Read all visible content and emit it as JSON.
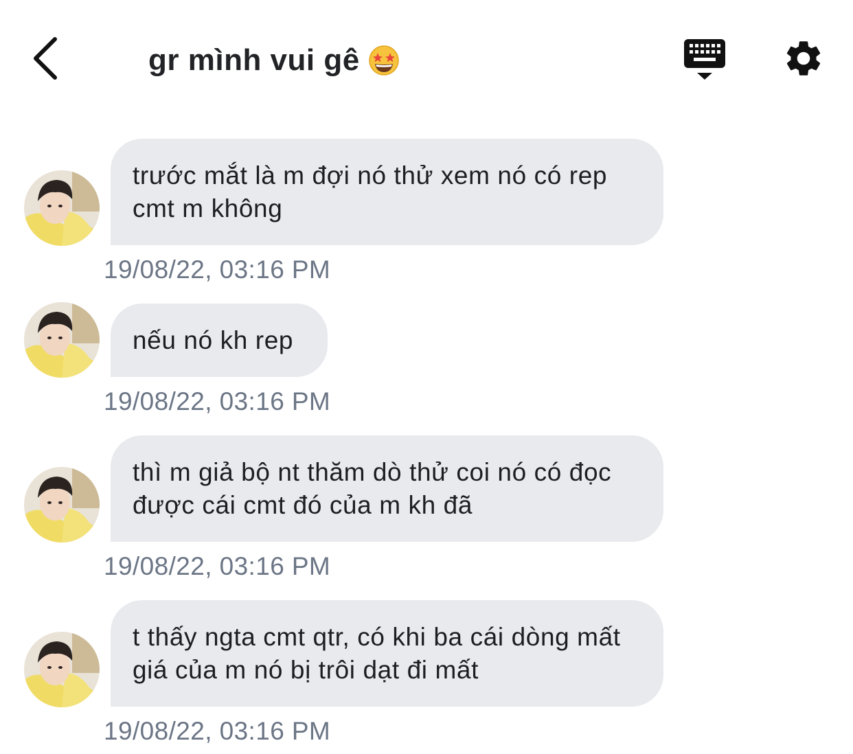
{
  "header": {
    "title": "gr mình vui gê",
    "title_emoji": "star-struck-emoji",
    "back_icon": "chevron-left-icon",
    "keyboard_icon": "keyboard-icon",
    "settings_icon": "gear-icon"
  },
  "colors": {
    "bubble_bg": "#e8eaee",
    "timestamp": "#6b7585",
    "text": "#1c1e21",
    "icons": "#111111"
  },
  "messages": [
    {
      "text": "trước mắt là m đợi nó thử xem nó có rep cmt m không",
      "time": "19/08/22, 03:16 PM"
    },
    {
      "text": "nếu nó kh rep",
      "time": "19/08/22, 03:16 PM"
    },
    {
      "text": "thì m giả bộ nt thăm dò thử coi nó có đọc được cái cmt đó của m kh đã",
      "time": "19/08/22, 03:16 PM"
    },
    {
      "text": "t thấy ngta cmt qtr, có khi ba cái dòng mất giá của m nó bị trôi dạt đi mất",
      "time": "19/08/22, 03:16 PM"
    }
  ]
}
